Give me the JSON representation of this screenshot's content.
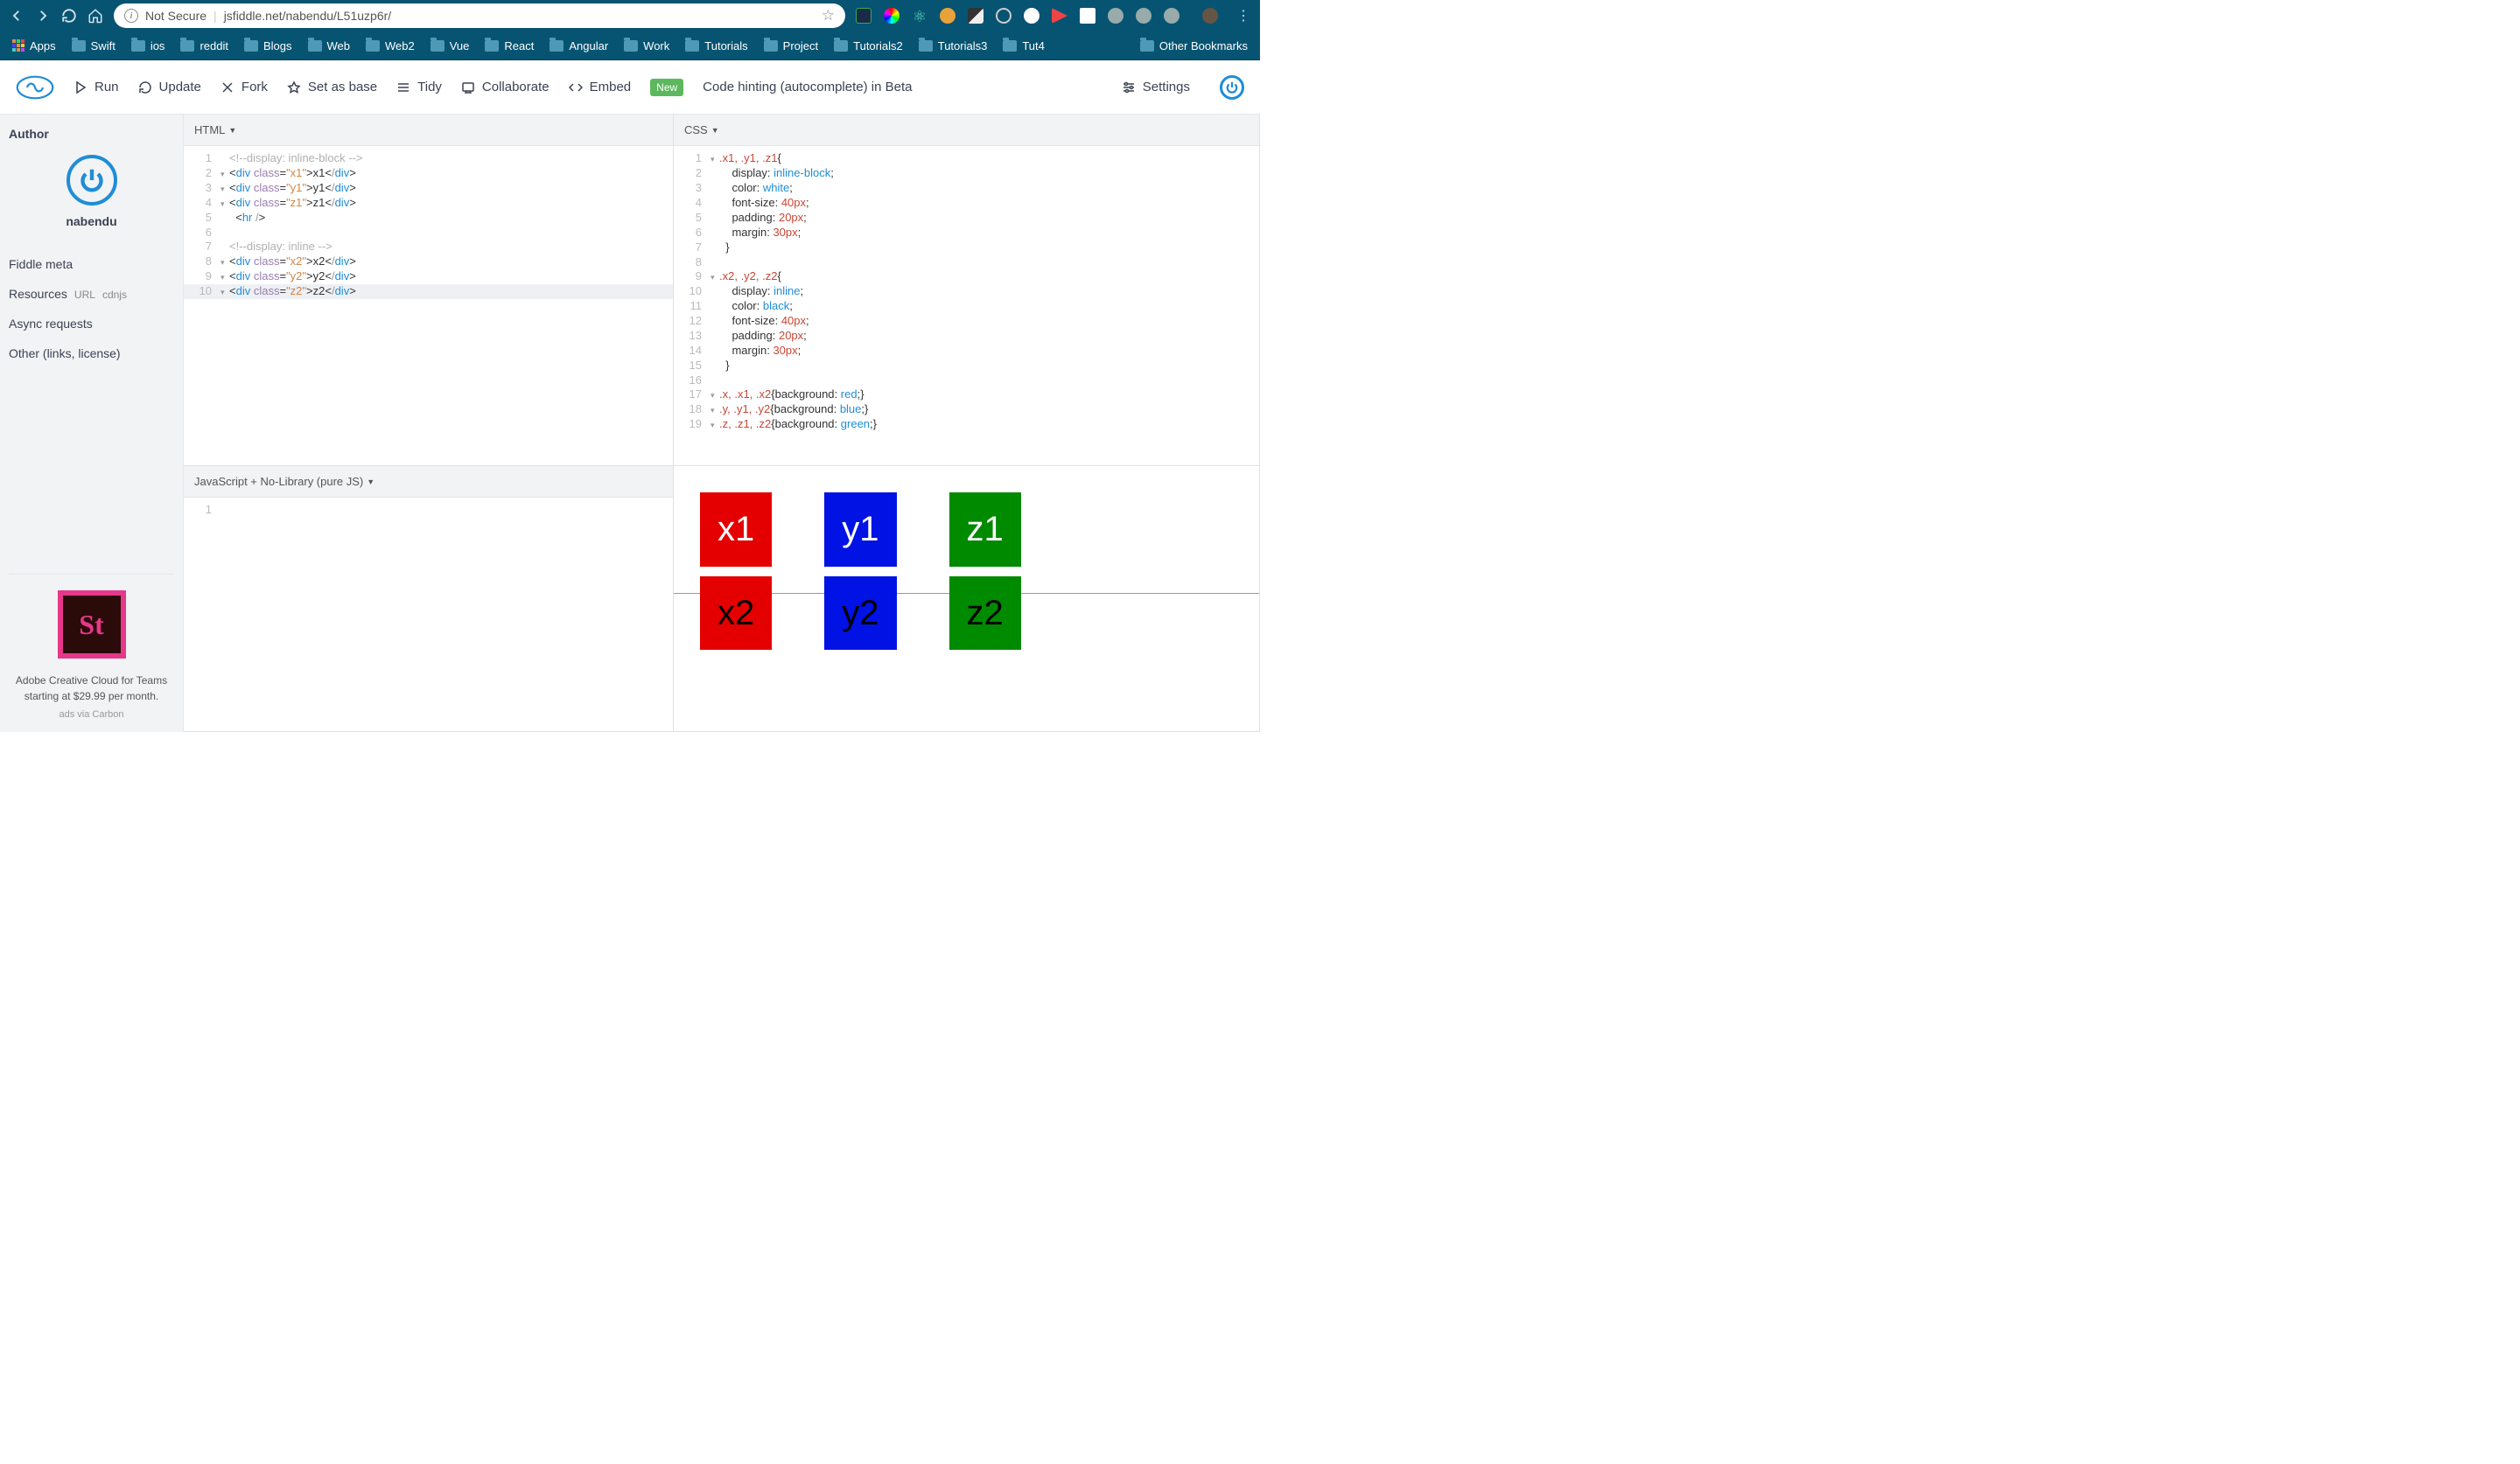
{
  "browser": {
    "not_secure": "Not Secure",
    "url": "jsfiddle.net/nabendu/L51uzp6r/"
  },
  "bookmarks": {
    "apps": "Apps",
    "items": [
      "Swift",
      "ios",
      "reddit",
      "Blogs",
      "Web",
      "Web2",
      "Vue",
      "React",
      "Angular",
      "Work",
      "Tutorials",
      "Project",
      "Tutorials2",
      "Tutorials3",
      "Tut4"
    ],
    "other": "Other Bookmarks"
  },
  "header": {
    "run": "Run",
    "update": "Update",
    "fork": "Fork",
    "set_base": "Set as base",
    "tidy": "Tidy",
    "collaborate": "Collaborate",
    "embed": "Embed",
    "new": "New",
    "hint": "Code hinting (autocomplete) in Beta",
    "settings": "Settings"
  },
  "sidebar": {
    "author_h": "Author",
    "author_name": "nabendu",
    "items": [
      "Fiddle meta",
      "Async requests",
      "Other (links, license)"
    ],
    "resources": "Resources",
    "url": "URL",
    "cdnjs": "cdnjs",
    "ad_line1": "Adobe Creative Cloud for Teams",
    "ad_line2": "starting at $29.99 per month.",
    "ads_via": "ads via Carbon",
    "adobe_st": "St"
  },
  "panes": {
    "html": "HTML",
    "css": "CSS",
    "js": "JavaScript + No-Library (pure JS)"
  },
  "html_code": {
    "l1": "<!--display: inline-block -->",
    "l2a": "div",
    "l2b": "class",
    "l2c": "\"x1\"",
    "l2d": "x1",
    "l2e": "div",
    "l3a": "div",
    "l3b": "class",
    "l3c": "\"y1\"",
    "l3d": "y1",
    "l3e": "div",
    "l4a": "div",
    "l4b": "class",
    "l4c": "\"z1\"",
    "l4d": "z1",
    "l4e": "div",
    "l5a": "hr",
    "l7": "<!--display: inline -->",
    "l8a": "div",
    "l8b": "class",
    "l8c": "\"x2\"",
    "l8d": "x2",
    "l8e": "div",
    "l9a": "div",
    "l9b": "class",
    "l9c": "\"y2\"",
    "l9d": "y2",
    "l9e": "div",
    "l10a": "div",
    "l10b": "class",
    "l10c": "\"z2\"",
    "l10d": "z2",
    "l10e": "div"
  },
  "css_code": {
    "l1": ".x1, .y1, .z1",
    "l2p": "display",
    "l2v": "inline-block",
    "l3p": "color",
    "l3v": "white",
    "l4p": "font-size",
    "l4v": "40px",
    "l5p": "padding",
    "l5v": "20px",
    "l6p": "margin",
    "l6v": "30px",
    "l9": ".x2, .y2, .z2",
    "l10p": "display",
    "l10v": "inline",
    "l11p": "color",
    "l11v": "black",
    "l12p": "font-size",
    "l12v": "40px",
    "l13p": "padding",
    "l13v": "20px",
    "l14p": "margin",
    "l14v": "30px",
    "l17s": ".x, .x1, .x2",
    "l17p": "background",
    "l17v": "red",
    "l18s": ".y, .y1, .y2",
    "l18p": "background",
    "l18v": "blue",
    "l19s": ".z, .z1, .z2",
    "l19p": "background",
    "l19v": "green"
  },
  "gutters": {
    "h": [
      "1",
      "2",
      "3",
      "4",
      "5",
      "6",
      "7",
      "8",
      "9",
      "10"
    ],
    "c": [
      "1",
      "2",
      "3",
      "4",
      "5",
      "6",
      "7",
      "8",
      "9",
      "10",
      "11",
      "12",
      "13",
      "14",
      "15",
      "16",
      "17",
      "18",
      "19"
    ],
    "j": [
      "1"
    ]
  },
  "result": {
    "x1": "x1",
    "y1": "y1",
    "z1": "z1",
    "x2": "x2",
    "y2": "y2",
    "z2": "z2"
  }
}
